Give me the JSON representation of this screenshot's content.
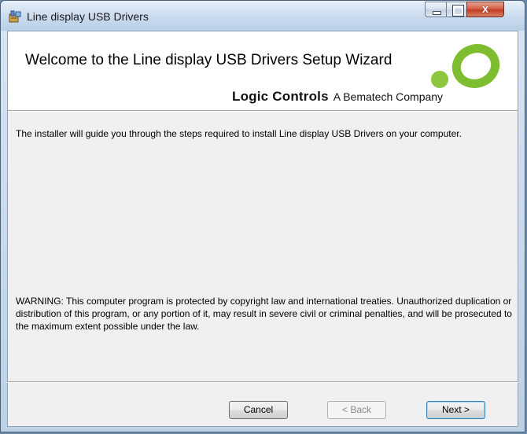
{
  "window": {
    "title": "Line display USB Drivers",
    "controls": {
      "minimize_icon": "minimize-icon",
      "maximize_icon": "maximize-icon",
      "close_icon": "close-icon",
      "close_glyph": "x"
    },
    "app_icon": "installer-icon"
  },
  "banner": {
    "title": "Welcome to the Line display USB Drivers Setup Wizard",
    "brand_name": "Logic Controls",
    "brand_tagline": "A Bematech Company",
    "logo_colors": {
      "dot": "#8dc63f",
      "ring": "#7dbd2f"
    }
  },
  "body": {
    "intro": "The installer will guide you through the steps required to install Line display USB Drivers on your computer.",
    "warning": "WARNING: This computer program is protected by copyright law and international treaties. Unauthorized duplication or distribution of this program, or any portion of it, may result in severe civil or criminal penalties, and will be prosecuted to the maximum extent possible under the law."
  },
  "buttons": {
    "cancel": "Cancel",
    "back": "< Back",
    "back_enabled": false,
    "next": "Next >"
  }
}
